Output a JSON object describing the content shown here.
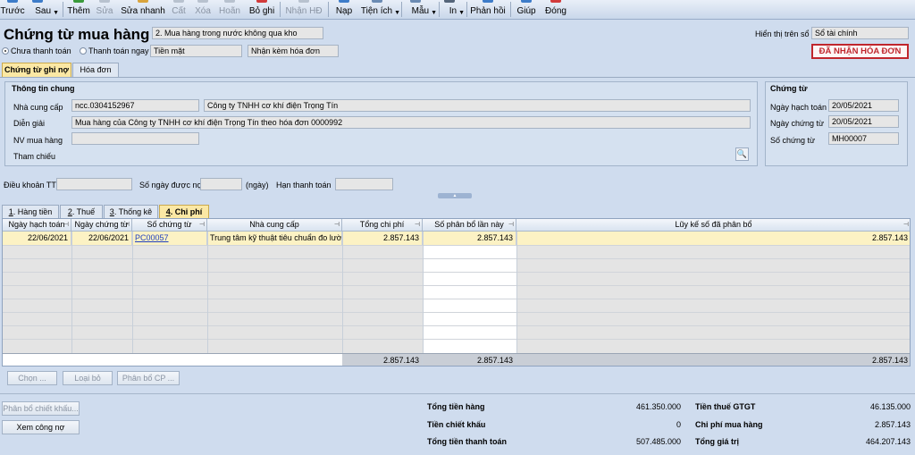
{
  "toolbar": {
    "items": [
      {
        "label": "Trước",
        "enabled": true
      },
      {
        "label": "Sau",
        "enabled": true
      },
      {
        "label": "Thêm",
        "enabled": true
      },
      {
        "label": "Sửa",
        "enabled": false
      },
      {
        "label": "Sửa nhanh",
        "enabled": true
      },
      {
        "label": "Cất",
        "enabled": false
      },
      {
        "label": "Xóa",
        "enabled": false
      },
      {
        "label": "Hoãn",
        "enabled": false
      },
      {
        "label": "Bỏ ghi",
        "enabled": true
      },
      {
        "label": "Nhận HĐ",
        "enabled": false
      },
      {
        "label": "Nạp",
        "enabled": true
      },
      {
        "label": "Tiện ích",
        "enabled": true
      },
      {
        "label": "Mẫu",
        "enabled": true
      },
      {
        "label": "In",
        "enabled": true
      },
      {
        "label": "Phản hồi",
        "enabled": true
      },
      {
        "label": "Giúp",
        "enabled": true
      },
      {
        "label": "Đóng",
        "enabled": true
      }
    ]
  },
  "header": {
    "title": "Chứng từ mua hàng",
    "purchase_type": "2. Mua hàng trong nước không qua kho",
    "payment_unpaid": "Chưa thanh toán",
    "payment_now": "Thanh toán ngay",
    "payment_method": "Tiền mặt",
    "invoice_option": "Nhận kèm hóa đơn",
    "display_label": "Hiển thị trên sổ",
    "display_value": "Sổ tài chính",
    "status_badge": "ĐÃ NHẬN HÓA ĐƠN"
  },
  "doc_tabs": [
    "Chứng từ ghi nợ",
    "Hóa đơn"
  ],
  "general": {
    "section_title": "Thông tin chung",
    "supplier_label": "Nhà cung cấp",
    "supplier_code": "ncc.0304152967",
    "supplier_name": "Công ty TNHH cơ khí điện Trọng Tín",
    "description_label": "Diễn giải",
    "description": "Mua hàng của Công ty TNHH cơ khí điện Trọng Tín theo hóa đơn 0000992",
    "buyer_label": "NV mua hàng",
    "buyer": "",
    "reference_label": "Tham chiếu"
  },
  "voucher": {
    "section_title": "Chứng từ",
    "posting_date_label": "Ngày hạch toán",
    "posting_date": "20/05/2021",
    "voucher_date_label": "Ngày chứng từ",
    "voucher_date": "20/05/2021",
    "voucher_no_label": "Số chứng từ",
    "voucher_no": "MH00007"
  },
  "terms": {
    "terms_label": "Điều khoản TT",
    "credit_days_label": "Số ngày được nợ",
    "days_unit": "(ngày)",
    "due_label": "Hạn thanh toán"
  },
  "detail_tabs": [
    {
      "key": "1",
      "label": ". Hàng tiền"
    },
    {
      "key": "2",
      "label": ". Thuế"
    },
    {
      "key": "3",
      "label": ". Thống kê"
    },
    {
      "key": "4",
      "label": ". Chi phí"
    }
  ],
  "grid": {
    "columns": [
      "Ngày hạch toán",
      "Ngày chứng từ",
      "Số chứng từ",
      "Nhà cung cấp",
      "Tổng chi phí",
      "Số phân bổ lần này",
      "Lũy kế số đã phân bổ"
    ],
    "rows": [
      {
        "posting_date": "22/06/2021",
        "voucher_date": "22/06/2021",
        "voucher_no": "PC00057",
        "supplier": "Trung tâm kỹ thuật tiêu chuẩn đo lường",
        "total_cost": "2.857.143",
        "allocated_now": "2.857.143",
        "allocated_cumulative": "2.857.143"
      }
    ],
    "footer": {
      "total_cost": "2.857.143",
      "allocated_now": "2.857.143",
      "allocated_cumulative": "2.857.143"
    }
  },
  "grid_buttons": [
    "Chọn ...",
    "Loại bỏ",
    "Phân bổ CP ..."
  ],
  "bottom_buttons": {
    "discount": "Phân bổ chiết khấu...",
    "debt": "Xem công nợ"
  },
  "summary": {
    "goods_total_label": "Tổng tiền hàng",
    "goods_total": "461.350.000",
    "vat_label": "Tiền thuế GTGT",
    "vat": "46.135.000",
    "discount_label": "Tiền chiết khấu",
    "discount": "0",
    "purchase_cost_label": "Chi phí mua hàng",
    "purchase_cost": "2.857.143",
    "payment_total_label": "Tổng tiền thanh toán",
    "payment_total": "507.485.000",
    "value_total_label": "Tổng giá trị",
    "value_total": "464.207.143"
  },
  "colors": {
    "accent": "#c0262d",
    "active_tab": "#fbe8a4",
    "background": "#cfdcee",
    "link": "#1f3fbf"
  },
  "icons": [
    "prev-icon",
    "next-icon",
    "add-icon",
    "edit-icon",
    "quick-edit-icon",
    "save-icon",
    "delete-icon",
    "postpone-icon",
    "unpost-icon",
    "receive-invoice-icon",
    "reload-icon",
    "utility-icon",
    "template-icon",
    "print-icon",
    "feedback-icon",
    "help-icon",
    "close-icon",
    "search-icon",
    "pin-icon",
    "collapse-icon"
  ]
}
